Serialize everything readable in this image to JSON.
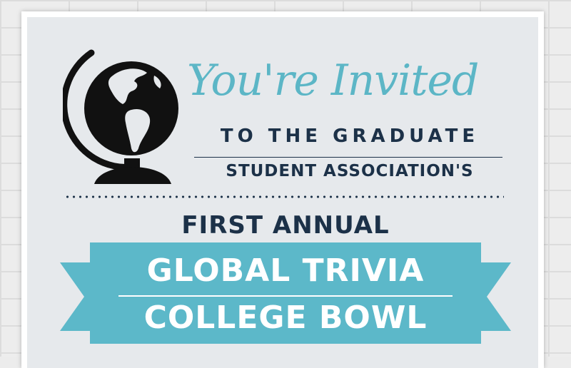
{
  "heading": {
    "invited": "You're Invited",
    "line1": "TO THE GRADUATE",
    "line2": "STUDENT ASSOCIATION'S"
  },
  "event": {
    "first_annual": "FIRST ANNUAL",
    "ribbon_line1": "GLOBAL TRIVIA",
    "ribbon_line2": "COLLEGE BOWL"
  },
  "colors": {
    "navy": "#1c3148",
    "teal": "#5cb6c6",
    "ribbon": "#5cb8c9",
    "ribbon_dark": "#4a9fb0",
    "panel": "#e6e9ec"
  },
  "icons": {
    "globe": "globe-icon"
  }
}
